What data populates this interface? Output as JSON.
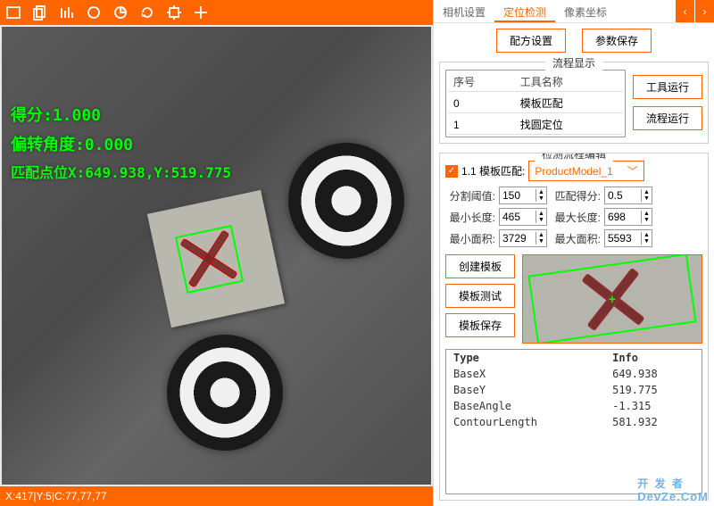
{
  "toolbar_icons": [
    "rect",
    "copy",
    "bars",
    "circle",
    "pie",
    "refresh",
    "target",
    "plus"
  ],
  "overlay": {
    "score_label": "得分:1.000",
    "angle_label": "偏转角度:0.000",
    "match_label": "匹配点位X:649.938,Y:519.775"
  },
  "status": "X:417|Y:5|C:77,77,77",
  "tabs": [
    "相机设置",
    "定位检测",
    "像素坐标"
  ],
  "active_tab": 1,
  "top_buttons": {
    "recipe": "配方设置",
    "save_param": "参数保存"
  },
  "flow_section": {
    "title": "流程显示",
    "cols": [
      "序号",
      "工具名称"
    ],
    "rows": [
      [
        "0",
        "模板匹配"
      ],
      [
        "1",
        "找圆定位"
      ]
    ],
    "run_tool": "工具运行",
    "run_flow": "流程运行"
  },
  "edit_section": {
    "title": "检测流程编辑",
    "check_label": "1.1 模板匹配:",
    "model_name": "ProductModel_1",
    "params": {
      "seg_thresh": {
        "label": "分割阈值:",
        "value": "150"
      },
      "match_score": {
        "label": "匹配得分:",
        "value": "0.5"
      },
      "min_len": {
        "label": "最小长度:",
        "value": "465"
      },
      "max_len": {
        "label": "最大长度:",
        "value": "698"
      },
      "min_area": {
        "label": "最小面积:",
        "value": "3729"
      },
      "max_area": {
        "label": "最大面积:",
        "value": "5593"
      }
    },
    "tpl_buttons": {
      "create": "创建模板",
      "test": "模板测试",
      "save": "模板保存"
    }
  },
  "info": {
    "head": [
      "Type",
      "Info"
    ],
    "rows": [
      [
        "BaseX",
        "649.938"
      ],
      [
        "BaseY",
        "519.775"
      ],
      [
        "BaseAngle",
        "-1.315"
      ],
      [
        "ContourLength",
        "581.932"
      ]
    ]
  },
  "watermark": {
    "cn": "开 发 者",
    "en": "DevZe.CoM"
  }
}
